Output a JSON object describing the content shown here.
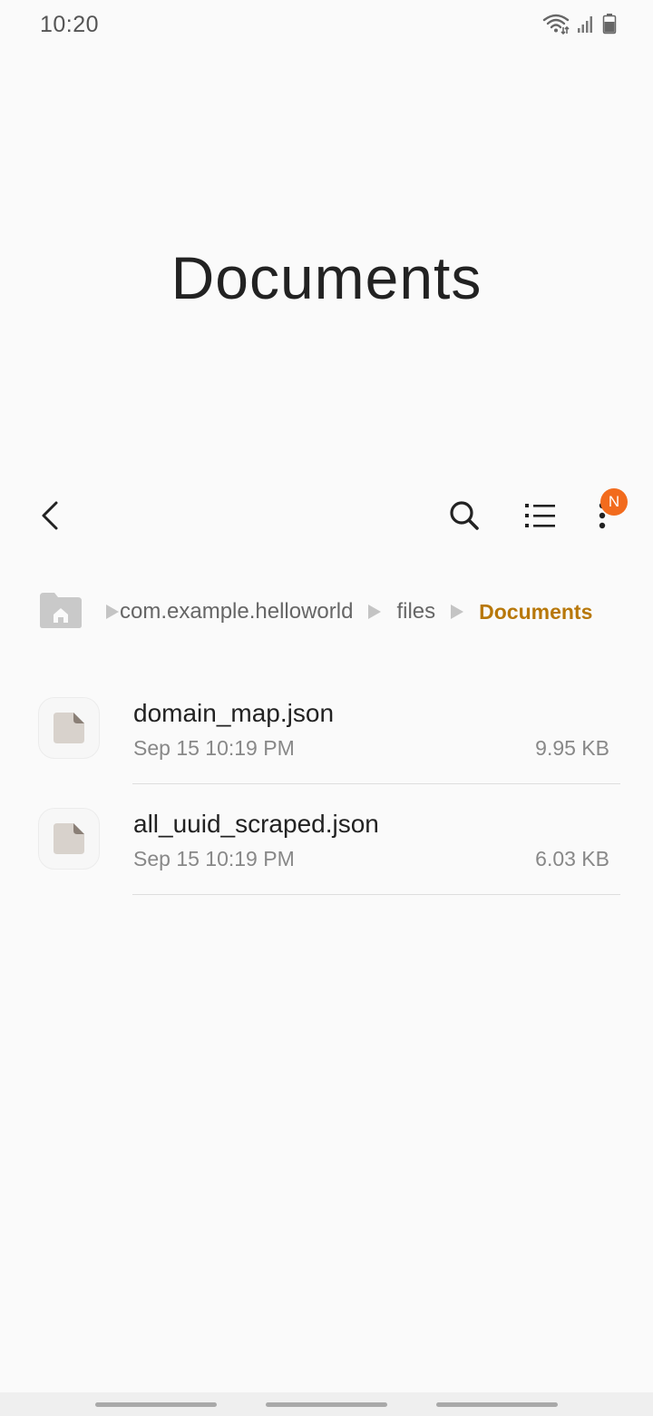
{
  "status_bar": {
    "time": "10:20",
    "icons": [
      "wifi-icon",
      "signal-icon",
      "battery-icon"
    ]
  },
  "header": {
    "title": "Documents"
  },
  "toolbar": {
    "back_icon": "back-arrow-icon",
    "search_icon": "search-icon",
    "view_icon": "list-view-icon",
    "more_icon": "more-options-icon",
    "badge_text": "N",
    "badge_color": "#f26b1d"
  },
  "breadcrumb": {
    "home_icon": "home-folder-icon",
    "items": [
      "com.example.helloworld",
      "files",
      "Documents"
    ],
    "active_color": "#b8780a"
  },
  "files": [
    {
      "name": "domain_map.json",
      "date": "Sep 15 10:19 PM",
      "size": "9.95 KB",
      "icon": "file-icon"
    },
    {
      "name": "all_uuid_scraped.json",
      "date": "Sep 15 10:19 PM",
      "size": "6.03 KB",
      "icon": "file-icon"
    }
  ],
  "nav_bar": {
    "buttons": [
      "recent-apps-button",
      "home-button",
      "back-button"
    ]
  }
}
